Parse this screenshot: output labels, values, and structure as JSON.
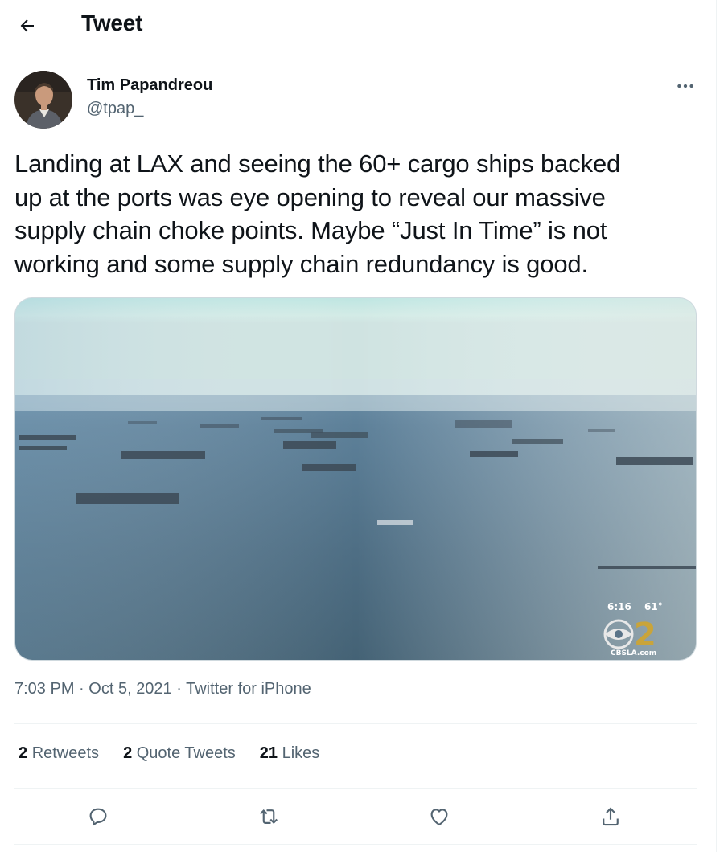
{
  "header": {
    "title": "Tweet",
    "back_icon": "arrow-left-icon"
  },
  "author": {
    "name": "Tim Papandreou",
    "handle": "@tpap_"
  },
  "tweet": {
    "text": "Landing at LAX and seeing the 60+ cargo ships backed\nup at the ports was eye opening to reveal our massive\nsupply chain choke points. Maybe “Just In Time” is not\nworking and some supply chain redundancy is good.",
    "media": {
      "overlay_time": "6:16",
      "overlay_temp": "61°",
      "watermark_number": "2",
      "watermark_site": "CBSLA.com"
    },
    "time": "7:03 PM",
    "date": "Oct 5, 2021",
    "source": "Twitter for iPhone",
    "separator": "·"
  },
  "stats": {
    "retweets_count": "2",
    "retweets_label": "Retweets",
    "quote_count": "2",
    "quote_label": "Quote Tweets",
    "likes_count": "21",
    "likes_label": "Likes"
  },
  "actions": [
    "reply-icon",
    "retweet-icon",
    "like-icon",
    "share-icon"
  ],
  "colors": {
    "text_primary": "#0f1419",
    "text_secondary": "#536471",
    "divider": "#eff3f4"
  }
}
